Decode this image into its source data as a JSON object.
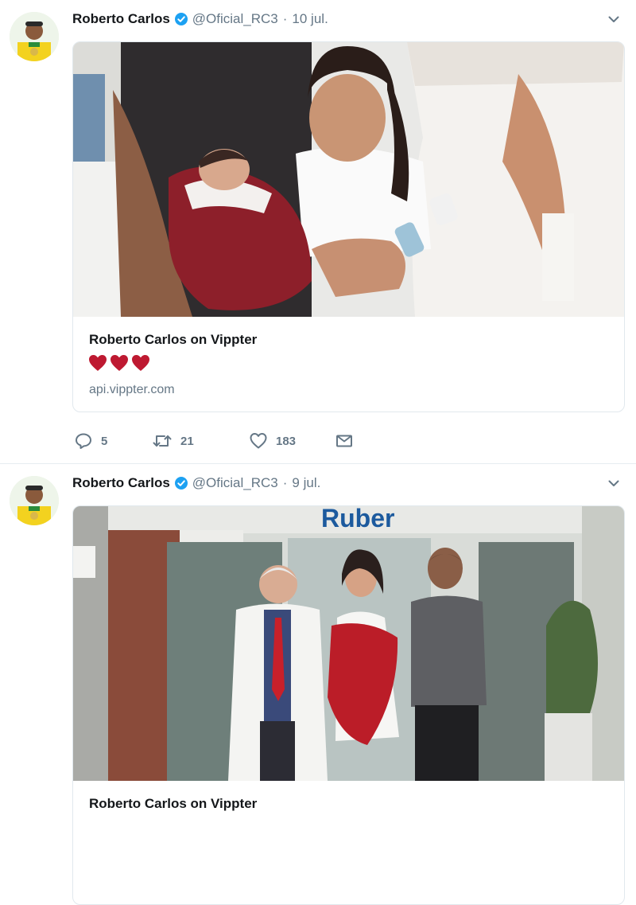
{
  "tweets": [
    {
      "author": {
        "name": "Roberto Carlos",
        "handle": "@Oficial_RC3",
        "verified": true
      },
      "separator": "·",
      "date": "10 jul.",
      "card": {
        "title": "Roberto Carlos on Vippter",
        "description_icons": [
          "heart-icon",
          "heart-icon",
          "heart-icon"
        ],
        "domain": "api.vippter.com"
      },
      "actions": {
        "replies": "5",
        "retweets": "21",
        "likes": "183"
      }
    },
    {
      "author": {
        "name": "Roberto Carlos",
        "handle": "@Oficial_RC3",
        "verified": true
      },
      "separator": "·",
      "date": "9 jul.",
      "card": {
        "title": "Roberto Carlos on Vippter",
        "image_signage": "Ruber"
      }
    }
  ],
  "colors": {
    "verified": "#1da1f2",
    "muted": "#657786",
    "heart": "#be1931",
    "text": "#14171a"
  }
}
